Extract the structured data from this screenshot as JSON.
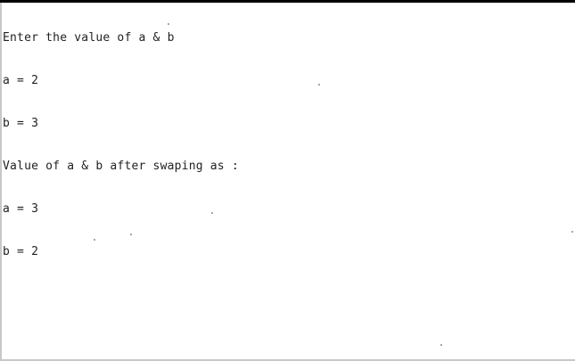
{
  "console": {
    "lines": [
      "Enter the value of a & b",
      "a = 2",
      "b = 3",
      "Value of a & b after swaping as :",
      "a = 3",
      "b = 2"
    ]
  }
}
